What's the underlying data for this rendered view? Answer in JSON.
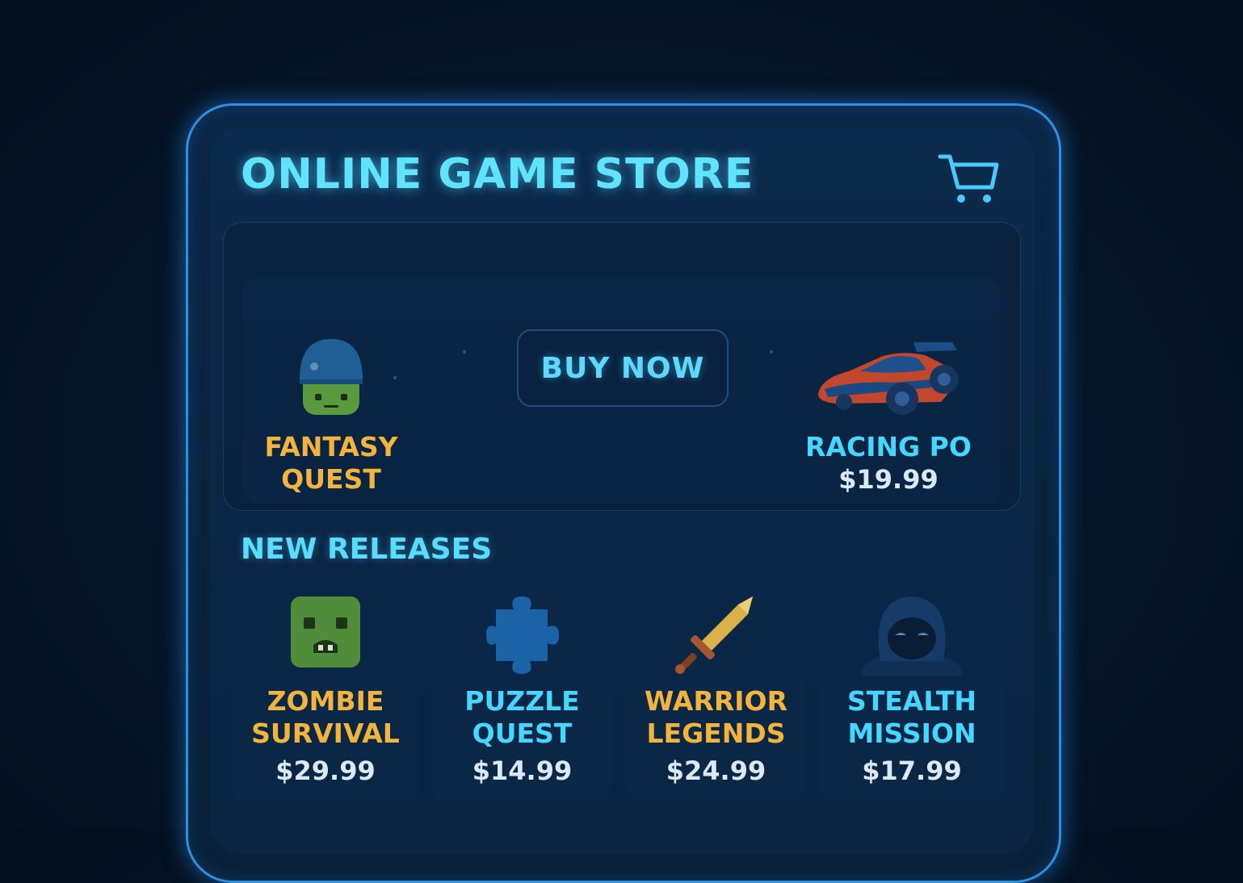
{
  "header": {
    "title": "ONLINE GAME STORE",
    "cart_icon": "shopping-cart-icon"
  },
  "featured": {
    "left": {
      "title": "FANTASY\nQUEST",
      "icon": "soldier-helmet-icon",
      "title_color": "#f2b43c"
    },
    "buy_button_label": "BUY NOW",
    "right": {
      "title": "RACING PO",
      "price": "$19.99",
      "icon": "race-car-icon",
      "title_color": "#45d7ff"
    }
  },
  "new_releases": {
    "title": "NEW RELEASES",
    "items": [
      {
        "title": "ZOMBIE\nSURVIVAL",
        "price": "$29.99",
        "icon": "zombie-face-icon",
        "title_color": "#f2b43c"
      },
      {
        "title": "PUZZLE\nQUEST",
        "price": "$14.99",
        "icon": "puzzle-piece-icon",
        "title_color": "#45d7ff"
      },
      {
        "title": "WARRIOR\nLEGENDS",
        "price": "$24.99",
        "icon": "sword-icon",
        "title_color": "#f2b43c"
      },
      {
        "title": "STEALTH\nMISSION",
        "price": "$17.99",
        "icon": "hooded-ninja-icon",
        "title_color": "#45d7ff"
      }
    ]
  },
  "colors": {
    "accent_cyan": "#5fe3ff",
    "accent_gold": "#f2b43c",
    "price_text": "#dbe8f6",
    "frame_glow": "#2f8fe0",
    "background": "#061629"
  }
}
